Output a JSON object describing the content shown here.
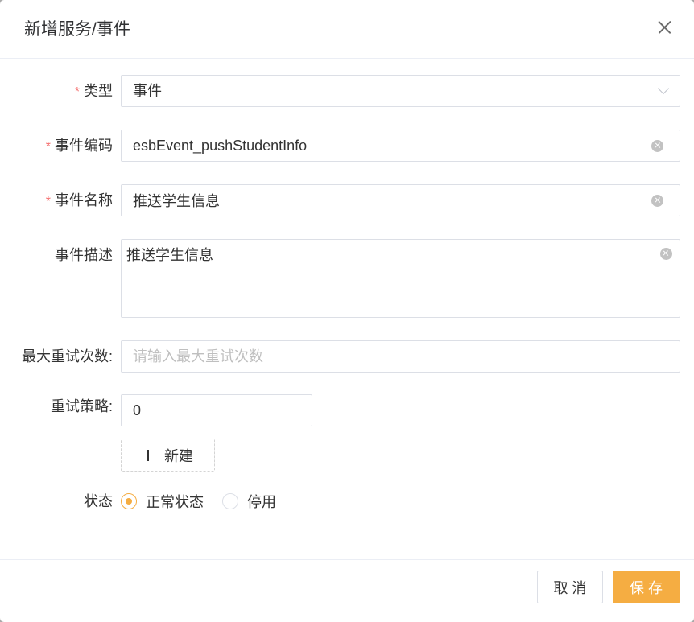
{
  "dialog": {
    "title": "新增服务/事件"
  },
  "form": {
    "required_mark": "*",
    "type": {
      "label": "类型",
      "required": true,
      "value": "事件"
    },
    "event_code": {
      "label": "事件编码",
      "required": true,
      "value": "esbEvent_pushStudentInfo"
    },
    "event_name": {
      "label": "事件名称",
      "required": true,
      "value": "推送学生信息"
    },
    "event_description": {
      "label": "事件描述",
      "required": false,
      "value": "推送学生信息"
    },
    "max_retries": {
      "label": "最大重试次数:",
      "required": false,
      "placeholder": "请输入最大重试次数"
    },
    "retry_strategy": {
      "label": "重试策略:",
      "required": false,
      "value": "0"
    },
    "add_strategy_button": {
      "label": "新建"
    },
    "status": {
      "label": "状态",
      "options": [
        {
          "label": "正常状态",
          "checked": true
        },
        {
          "label": "停用",
          "checked": false
        }
      ]
    }
  },
  "footer": {
    "cancel_label": "取 消",
    "save_label": "保 存"
  },
  "icons": {
    "close": "close-icon",
    "clear": "clear-icon",
    "dropdown": "chevron-down-icon",
    "add": "plus-icon"
  },
  "colors": {
    "accent": "#f5ad42",
    "required": "#f56c6c",
    "border": "#dcdfe6"
  }
}
